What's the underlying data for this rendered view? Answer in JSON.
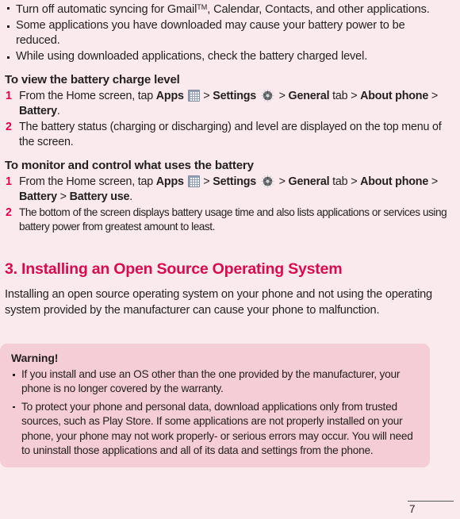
{
  "page": {
    "background_color": "#faeaee",
    "accent_color": "#d90b50",
    "step_number_color": "#e2004f",
    "warning_box_color": "#f5cdd6",
    "page_number": "7"
  },
  "top_bullets": [
    "Turn off automatic syncing for Gmail™, Calendar, Contacts, and other applications.",
    "Some applications you have downloaded may cause your battery power to be reduced.",
    "While using downloaded applications, check the battery charged level."
  ],
  "section_view_battery": {
    "heading": "To view the battery charge level",
    "steps": [
      {
        "number": "1",
        "parts": [
          {
            "text": "From the Home screen, tap ",
            "style": "normal"
          },
          {
            "text": "Apps",
            "style": "bold"
          },
          {
            "text": " ",
            "style": "normal"
          },
          {
            "icon": "apps-grid-icon"
          },
          {
            "text": " > ",
            "style": "normal"
          },
          {
            "text": "Settings",
            "style": "bold"
          },
          {
            "text": " ",
            "style": "normal"
          },
          {
            "icon": "settings-gear-icon"
          },
          {
            "text": " > ",
            "style": "normal"
          },
          {
            "text": "General",
            "style": "bold"
          },
          {
            "text": " tab > ",
            "style": "normal"
          },
          {
            "text": "About phone",
            "style": "bold"
          },
          {
            "text": " > ",
            "style": "normal"
          },
          {
            "text": "Battery",
            "style": "bold"
          },
          {
            "text": ".",
            "style": "normal"
          }
        ]
      },
      {
        "number": "2",
        "text": "The battery status (charging or discharging) and level are displayed on the top menu of the screen."
      }
    ]
  },
  "section_monitor_battery": {
    "heading": "To monitor and control what uses the battery",
    "steps": [
      {
        "number": "1",
        "parts": [
          {
            "text": "From the Home screen, tap ",
            "style": "normal"
          },
          {
            "text": "Apps",
            "style": "bold"
          },
          {
            "text": " ",
            "style": "normal"
          },
          {
            "icon": "apps-grid-icon"
          },
          {
            "text": " > ",
            "style": "normal"
          },
          {
            "text": "Settings",
            "style": "bold"
          },
          {
            "text": " ",
            "style": "normal"
          },
          {
            "icon": "settings-gear-icon"
          },
          {
            "text": " > ",
            "style": "normal"
          },
          {
            "text": "General",
            "style": "bold"
          },
          {
            "text": " tab > ",
            "style": "normal"
          },
          {
            "text": "About phone",
            "style": "bold"
          },
          {
            "text": " > ",
            "style": "normal"
          },
          {
            "text": "Battery",
            "style": "bold"
          },
          {
            "text": " > ",
            "style": "normal"
          },
          {
            "text": "Battery use",
            "style": "bold"
          },
          {
            "text": ".",
            "style": "normal"
          }
        ]
      },
      {
        "number": "2",
        "text": "The bottom of the screen displays battery usage time and also lists applications or services using battery power from greatest amount to least."
      }
    ]
  },
  "section_open_source": {
    "title": "3. Installing an Open Source Operating System",
    "paragraph": "Installing an open source operating system on your phone and not using the operating system provided by the manufacturer can cause your phone to malfunction."
  },
  "warning": {
    "title": "Warning!",
    "bullets": [
      "If you install and use an OS other than the one provided by the manufacturer, your phone is no longer covered by the warranty.",
      "To protect your phone and personal data, download applications only from trusted sources, such as Play Store. If some applications are not properly installed on your phone, your phone may not work properly- or serious errors may occur. You will need to uninstall those applications and all of its data and settings from the phone."
    ]
  }
}
